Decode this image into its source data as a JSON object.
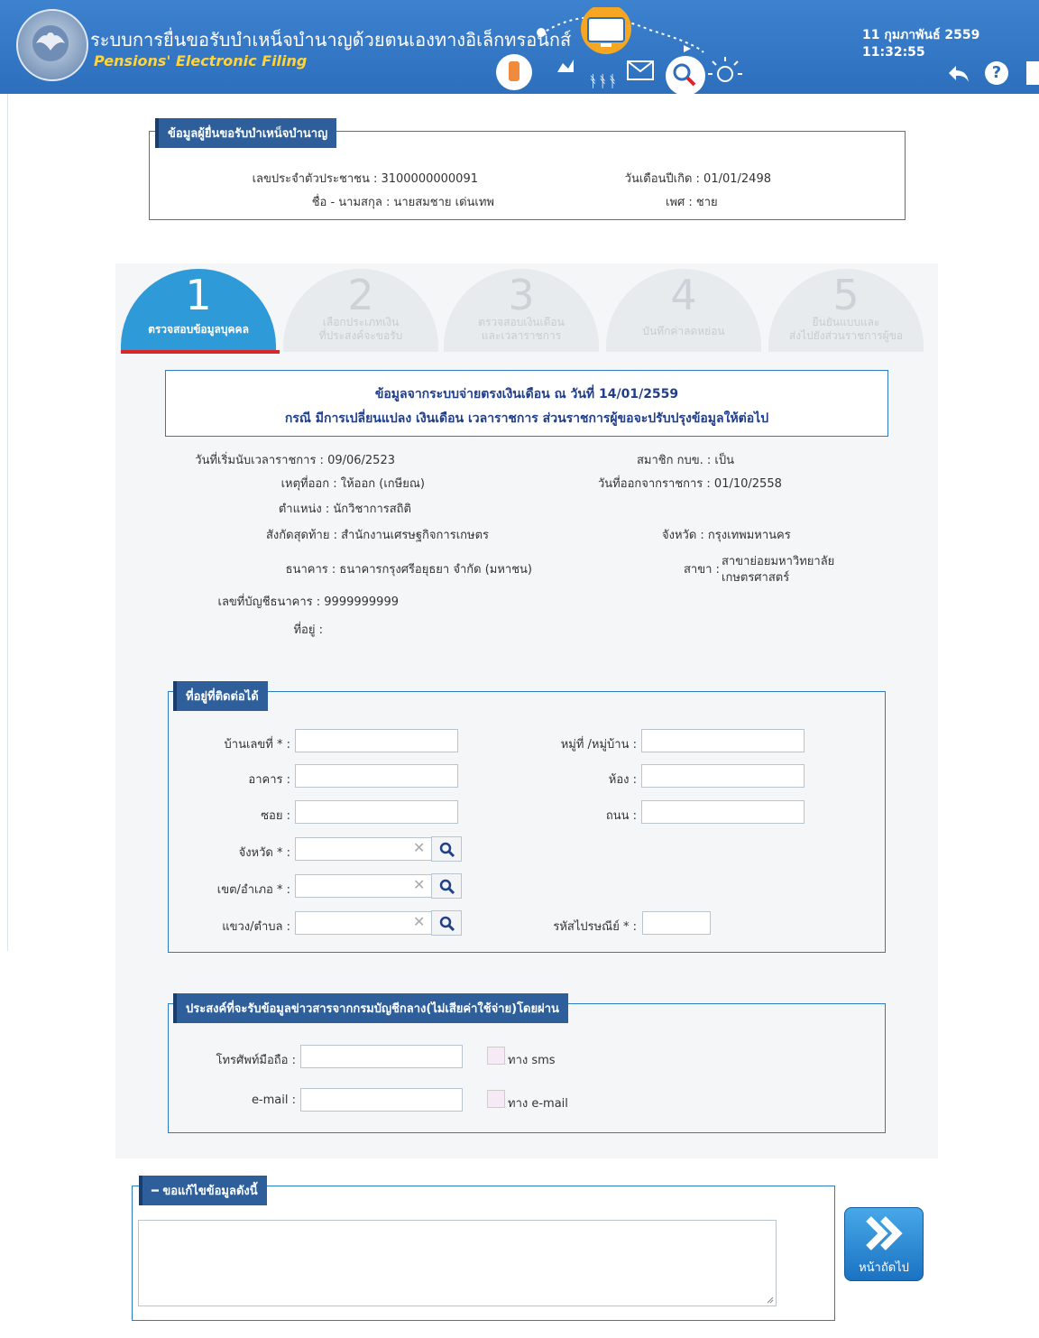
{
  "header": {
    "title_th": "ระบบการยื่นขอรับบำเหน็จบำนาญด้วยตนเองทางอิเล็กทรอนิกส์",
    "title_en": "Pensions' Electronic Filing",
    "datetime": "11 กุมภาพันธ์ 2559 11:32:55",
    "icons": [
      "back-icon",
      "help-icon",
      "menu-icon"
    ]
  },
  "applicant": {
    "legend": "ข้อมูลผู้ยื่นขอรับบำเหน็จบำนาญ",
    "id_label": "เลขประจำตัวประชาชน : 3100000000091",
    "birth_label": "วันเดือนปีเกิด : 01/01/2498",
    "name_label": "ชื่อ - นามสกุล : นายสมชาย เด่นเทพ",
    "sex_label": "เพศ : ชาย"
  },
  "steps": [
    {
      "num": "1",
      "label": "ตรวจสอบข้อมูลบุคคล",
      "active": true
    },
    {
      "num": "2",
      "label": "เลือกประเภทเงิน\nที่ประสงค์จะขอรับ",
      "active": false
    },
    {
      "num": "3",
      "label": "ตรวจสอบเงินเดือน\nและเวลาราชการ",
      "active": false
    },
    {
      "num": "4",
      "label": "บันทึกค่าลดหย่อน",
      "active": false
    },
    {
      "num": "5",
      "label": "ยืนยันแบบและ\nส่งไปยังส่วนราชการผู้ขอ",
      "active": false
    }
  ],
  "info": {
    "line1": "ข้อมูลจากระบบจ่ายตรงเงินเดือน ณ วันที่ 14/01/2559",
    "line2": "กรณี มีการเปลี่ยนแปลง เงินเดือน เวลาราชการ ส่วนราชการผู้ขอจะปรับปรุงข้อมูลให้ต่อไป"
  },
  "details": {
    "start_date": "วันที่เริ่มนับเวลาราชการ : 09/06/2523",
    "member": "สมาชิก กบข. : เป็น",
    "reason": "เหตุที่ออก : ให้ออก (เกษียณ)",
    "leave_date": "วันที่ออกจากราชการ : 01/10/2558",
    "position": "ตำแหน่ง : นักวิชาการสถิติ",
    "affiliation": "สังกัดสุดท้าย : สำนักงานเศรษฐกิจการเกษตร",
    "province": "จังหวัด : กรุงเทพมหานคร",
    "bank": "ธนาคาร : ธนาคารกรุงศรีอยุธยา จำกัด (มหาชน)",
    "branch_label": "สาขา :",
    "branch_line1": "สาขาย่อยมหาวิทยาลัย",
    "branch_line2": "เกษตรศาสตร์",
    "account": "เลขที่บัญชีธนาคาร : 9999999999",
    "address": "ที่อยู่ :"
  },
  "contact": {
    "legend": "ที่อยู่ที่ติดต่อได้",
    "house_no": "บ้านเลขที่ * :",
    "moo": "หมู่ที่ /หมู่บ้าน :",
    "building": "อาคาร :",
    "room": "ห้อง :",
    "soi": "ซอย :",
    "road": "ถนน :",
    "province": "จังหวัด * :",
    "district": "เขต/อำเภอ * :",
    "subdistrict": "แขวง/ตำบล :",
    "postcode": "รหัสไปรษณีย์ * :"
  },
  "news": {
    "legend": "ประสงค์ที่จะรับข้อมูลข่าวสารจากกรมบัญชีกลาง(ไม่เสียค่าใช้จ่าย)โดยผ่าน",
    "mobile_label": "โทรศัพท์มือถือ :",
    "sms_label": "ทาง sms",
    "email_label": "e-mail :",
    "email_check_label": "ทาง e-mail"
  },
  "edit": {
    "legend": "ขอแก้ไขข้อมูลดังนี้",
    "next_label": "หน้าถัดไป"
  },
  "colors": {
    "header": "#2d6fbd",
    "accent": "#2f9ad8",
    "legend": "#2f5f9a",
    "border": "#2e7cc0",
    "title_en": "#ffd43a"
  }
}
